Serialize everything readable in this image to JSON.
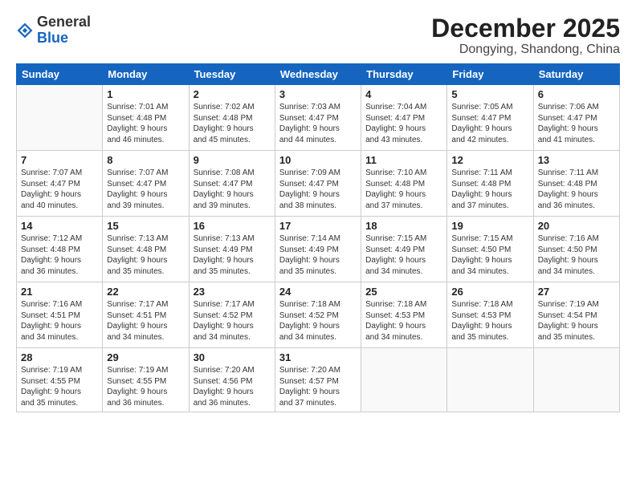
{
  "logo": {
    "general": "General",
    "blue": "Blue"
  },
  "header": {
    "month": "December 2025",
    "location": "Dongying, Shandong, China"
  },
  "weekdays": [
    "Sunday",
    "Monday",
    "Tuesday",
    "Wednesday",
    "Thursday",
    "Friday",
    "Saturday"
  ],
  "weeks": [
    [
      {
        "day": "",
        "info": ""
      },
      {
        "day": "1",
        "info": "Sunrise: 7:01 AM\nSunset: 4:48 PM\nDaylight: 9 hours\nand 46 minutes."
      },
      {
        "day": "2",
        "info": "Sunrise: 7:02 AM\nSunset: 4:48 PM\nDaylight: 9 hours\nand 45 minutes."
      },
      {
        "day": "3",
        "info": "Sunrise: 7:03 AM\nSunset: 4:47 PM\nDaylight: 9 hours\nand 44 minutes."
      },
      {
        "day": "4",
        "info": "Sunrise: 7:04 AM\nSunset: 4:47 PM\nDaylight: 9 hours\nand 43 minutes."
      },
      {
        "day": "5",
        "info": "Sunrise: 7:05 AM\nSunset: 4:47 PM\nDaylight: 9 hours\nand 42 minutes."
      },
      {
        "day": "6",
        "info": "Sunrise: 7:06 AM\nSunset: 4:47 PM\nDaylight: 9 hours\nand 41 minutes."
      }
    ],
    [
      {
        "day": "7",
        "info": "Sunrise: 7:07 AM\nSunset: 4:47 PM\nDaylight: 9 hours\nand 40 minutes."
      },
      {
        "day": "8",
        "info": "Sunrise: 7:07 AM\nSunset: 4:47 PM\nDaylight: 9 hours\nand 39 minutes."
      },
      {
        "day": "9",
        "info": "Sunrise: 7:08 AM\nSunset: 4:47 PM\nDaylight: 9 hours\nand 39 minutes."
      },
      {
        "day": "10",
        "info": "Sunrise: 7:09 AM\nSunset: 4:47 PM\nDaylight: 9 hours\nand 38 minutes."
      },
      {
        "day": "11",
        "info": "Sunrise: 7:10 AM\nSunset: 4:48 PM\nDaylight: 9 hours\nand 37 minutes."
      },
      {
        "day": "12",
        "info": "Sunrise: 7:11 AM\nSunset: 4:48 PM\nDaylight: 9 hours\nand 37 minutes."
      },
      {
        "day": "13",
        "info": "Sunrise: 7:11 AM\nSunset: 4:48 PM\nDaylight: 9 hours\nand 36 minutes."
      }
    ],
    [
      {
        "day": "14",
        "info": "Sunrise: 7:12 AM\nSunset: 4:48 PM\nDaylight: 9 hours\nand 36 minutes."
      },
      {
        "day": "15",
        "info": "Sunrise: 7:13 AM\nSunset: 4:48 PM\nDaylight: 9 hours\nand 35 minutes."
      },
      {
        "day": "16",
        "info": "Sunrise: 7:13 AM\nSunset: 4:49 PM\nDaylight: 9 hours\nand 35 minutes."
      },
      {
        "day": "17",
        "info": "Sunrise: 7:14 AM\nSunset: 4:49 PM\nDaylight: 9 hours\nand 35 minutes."
      },
      {
        "day": "18",
        "info": "Sunrise: 7:15 AM\nSunset: 4:49 PM\nDaylight: 9 hours\nand 34 minutes."
      },
      {
        "day": "19",
        "info": "Sunrise: 7:15 AM\nSunset: 4:50 PM\nDaylight: 9 hours\nand 34 minutes."
      },
      {
        "day": "20",
        "info": "Sunrise: 7:16 AM\nSunset: 4:50 PM\nDaylight: 9 hours\nand 34 minutes."
      }
    ],
    [
      {
        "day": "21",
        "info": "Sunrise: 7:16 AM\nSunset: 4:51 PM\nDaylight: 9 hours\nand 34 minutes."
      },
      {
        "day": "22",
        "info": "Sunrise: 7:17 AM\nSunset: 4:51 PM\nDaylight: 9 hours\nand 34 minutes."
      },
      {
        "day": "23",
        "info": "Sunrise: 7:17 AM\nSunset: 4:52 PM\nDaylight: 9 hours\nand 34 minutes."
      },
      {
        "day": "24",
        "info": "Sunrise: 7:18 AM\nSunset: 4:52 PM\nDaylight: 9 hours\nand 34 minutes."
      },
      {
        "day": "25",
        "info": "Sunrise: 7:18 AM\nSunset: 4:53 PM\nDaylight: 9 hours\nand 34 minutes."
      },
      {
        "day": "26",
        "info": "Sunrise: 7:18 AM\nSunset: 4:53 PM\nDaylight: 9 hours\nand 35 minutes."
      },
      {
        "day": "27",
        "info": "Sunrise: 7:19 AM\nSunset: 4:54 PM\nDaylight: 9 hours\nand 35 minutes."
      }
    ],
    [
      {
        "day": "28",
        "info": "Sunrise: 7:19 AM\nSunset: 4:55 PM\nDaylight: 9 hours\nand 35 minutes."
      },
      {
        "day": "29",
        "info": "Sunrise: 7:19 AM\nSunset: 4:55 PM\nDaylight: 9 hours\nand 36 minutes."
      },
      {
        "day": "30",
        "info": "Sunrise: 7:20 AM\nSunset: 4:56 PM\nDaylight: 9 hours\nand 36 minutes."
      },
      {
        "day": "31",
        "info": "Sunrise: 7:20 AM\nSunset: 4:57 PM\nDaylight: 9 hours\nand 37 minutes."
      },
      {
        "day": "",
        "info": ""
      },
      {
        "day": "",
        "info": ""
      },
      {
        "day": "",
        "info": ""
      }
    ]
  ]
}
